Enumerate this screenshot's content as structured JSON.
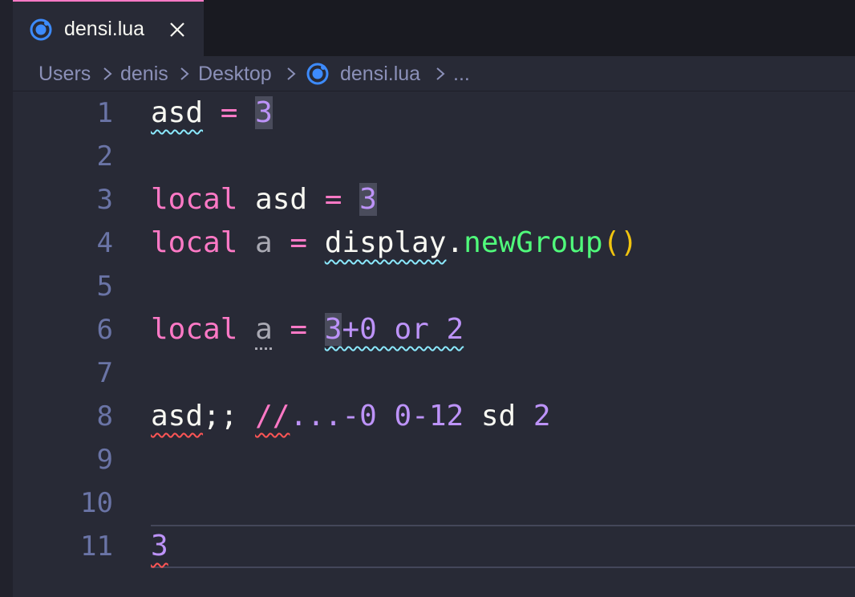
{
  "tab": {
    "filename": "densi.lua",
    "icon": "lua-file-icon",
    "close_icon": "close-icon"
  },
  "breadcrumb": {
    "items": [
      "Users",
      "denis",
      "Desktop",
      "densi.lua",
      "..."
    ]
  },
  "editor": {
    "line_numbers": [
      "1",
      "2",
      "3",
      "4",
      "5",
      "6",
      "7",
      "8",
      "9",
      "10",
      "11"
    ],
    "current_line": "11"
  },
  "code": {
    "l1": {
      "asd": "asd",
      "eq": " = ",
      "num": "3"
    },
    "l3": {
      "kw": "local",
      "asd": " asd",
      "eq": " = ",
      "num": "3"
    },
    "l4": {
      "kw": "local",
      "a": " a",
      "eq": " = ",
      "obj": "display",
      "dot": ".",
      "fn": "newGroup",
      "parens": "()"
    },
    "l6": {
      "kw": "local",
      "sp": " ",
      "a": "a",
      "eq": " = ",
      "n3": "3",
      "rest": "+0 or 2"
    },
    "l8": {
      "asd": "asd",
      "semi": ";; ",
      "slashes": "//",
      "dots": "...",
      "rest": "-0 0-12",
      "sd": " sd",
      "two": " 2"
    },
    "l11": {
      "num": "3"
    }
  },
  "colors": {
    "background": "#282a36",
    "tabbar": "#191a21",
    "keyword": "#ff79c6",
    "number": "#bd93f9",
    "function": "#50fa7b",
    "paren": "#f1c40f",
    "line_number": "#6a74a6",
    "breadcrumb": "#8b90b8",
    "tab_accent": "#ff79c6"
  }
}
